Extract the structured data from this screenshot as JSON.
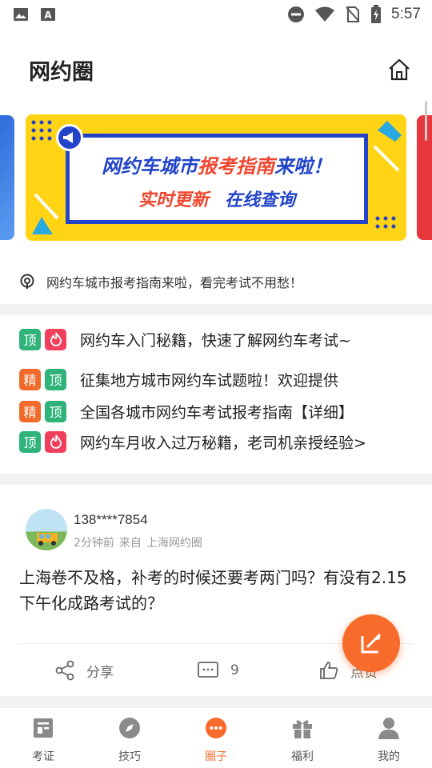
{
  "status_bar": {
    "time": "5:57"
  },
  "header": {
    "title": "网约圈"
  },
  "banner": {
    "line1_a": "网约车城市",
    "line1_b": "报考指南",
    "line1_c": "来啦！",
    "line2_a": "实时更新",
    "line2_b": "在线查询"
  },
  "notice": {
    "text": "网约车城市报考指南来啦，看完考试不用愁！"
  },
  "topics": [
    {
      "tags": [
        "顶",
        "hot"
      ],
      "text": "网约车入门秘籍，快速了解网约车考试~"
    },
    {
      "tags": [
        "精",
        "顶"
      ],
      "text": "征集地方城市网约车试题啦！欢迎提供"
    },
    {
      "tags": [
        "精",
        "顶"
      ],
      "text": "全国各城市网约车考试报考指南【详细】"
    },
    {
      "tags": [
        "顶",
        "hot"
      ],
      "text": "网约车月收入过万秘籍，老司机亲授经验>"
    }
  ],
  "post": {
    "username": "138****7854",
    "time": "2分钟前",
    "from": "来自",
    "circle": "上海网约圈",
    "body": "上海卷不及格，补考的时候还要考两门吗？有没有2.15下午化成路考试的？",
    "share_label": "分享",
    "comment_count": "9",
    "like_label": "点赞"
  },
  "tabbar": {
    "items": [
      {
        "label": "考证",
        "icon": "exam-icon"
      },
      {
        "label": "技巧",
        "icon": "compass-icon"
      },
      {
        "label": "圈子",
        "icon": "chat-bubble-icon"
      },
      {
        "label": "福利",
        "icon": "gift-icon"
      },
      {
        "label": "我的",
        "icon": "person-icon"
      }
    ],
    "active_index": 2
  },
  "colors": {
    "accent": "#f76b2b",
    "banner_blue": "#2344c9",
    "banner_yellow": "#ffd415",
    "tag_green": "#2fb37b",
    "tag_orange": "#f06b2a",
    "tag_red": "#f0405e"
  }
}
